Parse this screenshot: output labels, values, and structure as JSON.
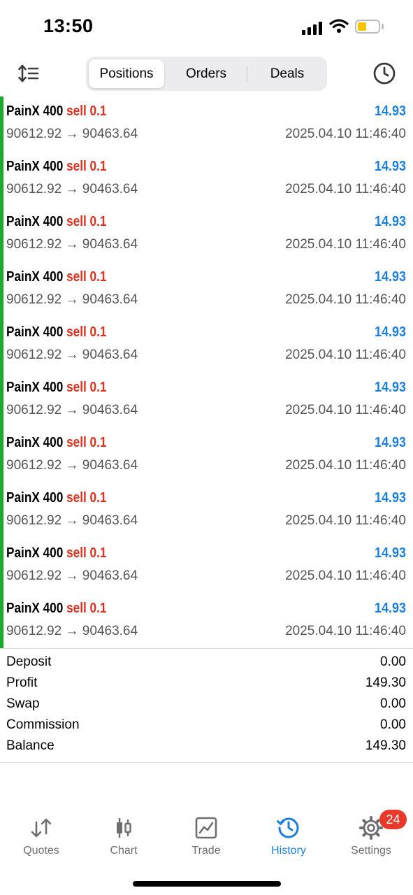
{
  "status_bar": {
    "time": "13:50"
  },
  "toolbar": {
    "tabs": [
      "Positions",
      "Orders",
      "Deals"
    ],
    "active_tab": "Positions"
  },
  "colors": {
    "accent": "#1b7fdc",
    "sell": "#e0301e",
    "list_bar": "#1aab2c",
    "badge": "#e8392c"
  },
  "deals": [
    {
      "symbol": "PainX 400",
      "type": "sell",
      "volume": "0.1",
      "profit": "14.93",
      "prices": "90612.92 → 90463.64",
      "time": "2025.04.10 11:46:40"
    },
    {
      "symbol": "PainX 400",
      "type": "sell",
      "volume": "0.1",
      "profit": "14.93",
      "prices": "90612.92 → 90463.64",
      "time": "2025.04.10 11:46:40"
    },
    {
      "symbol": "PainX 400",
      "type": "sell",
      "volume": "0.1",
      "profit": "14.93",
      "prices": "90612.92 → 90463.64",
      "time": "2025.04.10 11:46:40"
    },
    {
      "symbol": "PainX 400",
      "type": "sell",
      "volume": "0.1",
      "profit": "14.93",
      "prices": "90612.92 → 90463.64",
      "time": "2025.04.10 11:46:40"
    },
    {
      "symbol": "PainX 400",
      "type": "sell",
      "volume": "0.1",
      "profit": "14.93",
      "prices": "90612.92 → 90463.64",
      "time": "2025.04.10 11:46:40"
    },
    {
      "symbol": "PainX 400",
      "type": "sell",
      "volume": "0.1",
      "profit": "14.93",
      "prices": "90612.92 → 90463.64",
      "time": "2025.04.10 11:46:40"
    },
    {
      "symbol": "PainX 400",
      "type": "sell",
      "volume": "0.1",
      "profit": "14.93",
      "prices": "90612.92 → 90463.64",
      "time": "2025.04.10 11:46:40"
    },
    {
      "symbol": "PainX 400",
      "type": "sell",
      "volume": "0.1",
      "profit": "14.93",
      "prices": "90612.92 → 90463.64",
      "time": "2025.04.10 11:46:40"
    },
    {
      "symbol": "PainX 400",
      "type": "sell",
      "volume": "0.1",
      "profit": "14.93",
      "prices": "90612.92 → 90463.64",
      "time": "2025.04.10 11:46:40"
    },
    {
      "symbol": "PainX 400",
      "type": "sell",
      "volume": "0.1",
      "profit": "14.93",
      "prices": "90612.92 → 90463.64",
      "time": "2025.04.10 11:46:40"
    }
  ],
  "summary": [
    {
      "label": "Deposit",
      "value": "0.00"
    },
    {
      "label": "Profit",
      "value": "149.30"
    },
    {
      "label": "Swap",
      "value": "0.00"
    },
    {
      "label": "Commission",
      "value": "0.00"
    },
    {
      "label": "Balance",
      "value": "149.30"
    }
  ],
  "tabbar": {
    "items": [
      {
        "label": "Quotes",
        "icon": "quotes-arrows-icon"
      },
      {
        "label": "Chart",
        "icon": "candlestick-chart-icon"
      },
      {
        "label": "Trade",
        "icon": "trade-chart-icon"
      },
      {
        "label": "History",
        "icon": "history-clock-icon"
      },
      {
        "label": "Settings",
        "icon": "gear-icon"
      }
    ],
    "active": "History",
    "settings_badge": "24"
  }
}
